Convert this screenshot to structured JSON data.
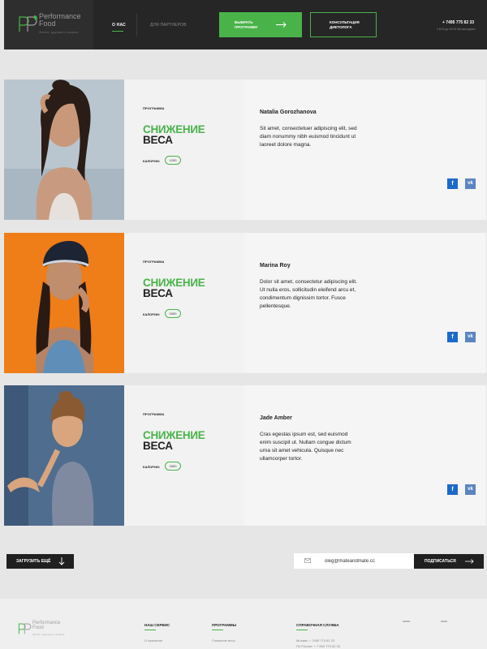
{
  "header": {
    "logo_name": "Performance Food",
    "logo_tagline": "Фитнес, здоровье и питание",
    "nav": [
      {
        "label": "О НАС"
      },
      {
        "label": "ДЛЯ ПАРТНЕРОВ"
      }
    ],
    "choose_program_button": "ВЫБРАТЬ ПРОГРАММУ",
    "consult_button": "КОНСУЛЬТАЦИЯ ДИЕТОЛОГА",
    "phone": "+ 7495 775 82 33",
    "phone_note": "с 8:00 до 20:00 без выходных"
  },
  "cards": [
    {
      "program_label": "ПРОГРАММА",
      "title_line1": "СНИЖЕНИЕ",
      "title_line2": "ВЕСА",
      "calories_label": "КАЛОРИИ:",
      "calories": "1200",
      "name": "Natalia Gorozhanova",
      "text": "Sit amet, consectetuer adipiscing elit, sed diam nonummy nibh euismod tincidunt ut laoreet dolore magna.",
      "fb": "f",
      "vk": "vk"
    },
    {
      "program_label": "ПРОГРАММА",
      "title_line1": "СНИЖЕНИЕ",
      "title_line2": "ВЕСА",
      "calories_label": "КАЛОРИИ:",
      "calories": "1500",
      "name": "Marina Roy",
      "text": "Dolor sit amet, consectetur adipiscing elit. Ut nulla eros, sollicitudin eleifend arcu et, condimentum dignissim tortor. Fusce pellentesque.",
      "fb": "f",
      "vk": "vk"
    },
    {
      "program_label": "ПРОГРАММА",
      "title_line1": "СНИЖЕНИЕ",
      "title_line2": "ВЕСА",
      "calories_label": "КАЛОРИИ:",
      "calories": "1800",
      "name": "Jade Amber",
      "text": "Cras egestas ipsum est, sed euismod enim suscipit ut. Nullam congue dictum urna sit amet vehicula. Quisque nec ullamcorper tortor.",
      "fb": "f",
      "vk": "vk"
    }
  ],
  "load_more_button": "ЗАГРУЗИТЬ ЕЩЁ",
  "email": {
    "value": "oleg@mateandmate.cc"
  },
  "subscribe_button": "ПОДПИСАТЬСЯ",
  "footer": {
    "logo_name": "Performance Food",
    "logo_tagline": "Фитнес, здоровье и питание",
    "columns": [
      {
        "heading": "НАШ СЕРВИС",
        "link": "О компании"
      },
      {
        "heading": "ПРОГРАММЫ",
        "link": "Снижение веса"
      },
      {
        "heading": "СПРАВОЧНАЯ СЛУЖБА",
        "link": "Москва: + 7495 775 82 33",
        "link2": "По России: + 7 800 775 82 33"
      }
    ]
  },
  "colors": {
    "accent": "#49b34a",
    "header_bg": "#262626",
    "facebook": "#1b6ac9",
    "vk": "#5b85c2"
  }
}
